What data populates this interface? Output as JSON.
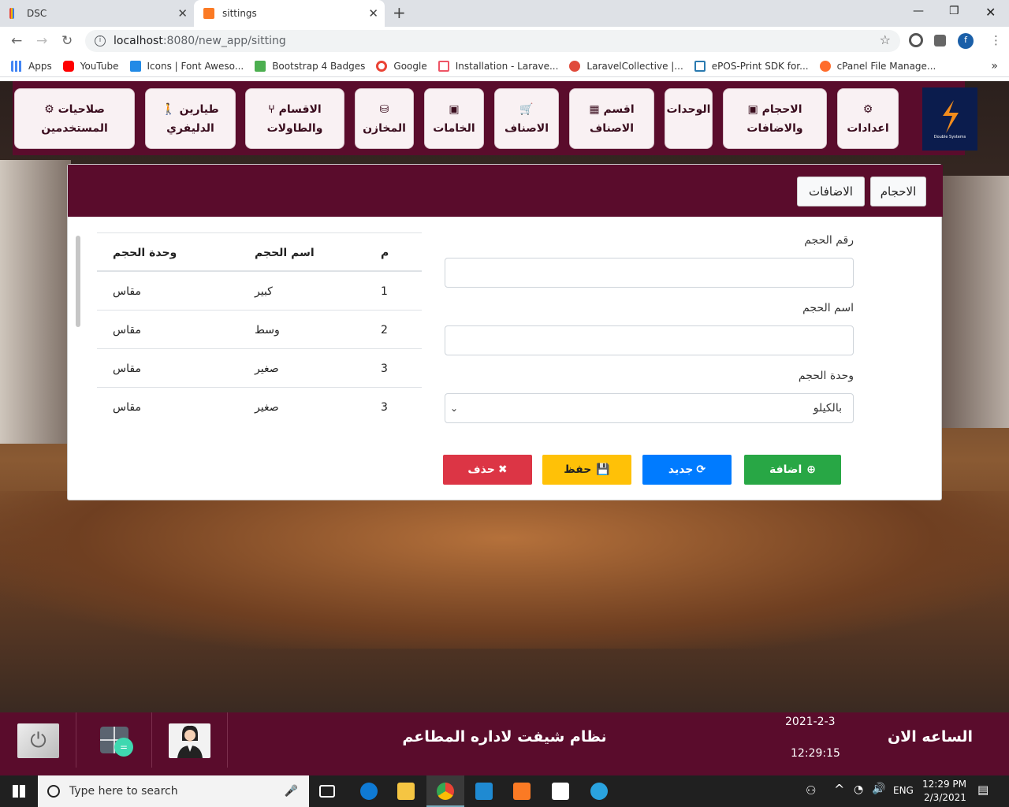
{
  "browser": {
    "tabs": [
      {
        "title": "DSC"
      },
      {
        "title": "sittings"
      }
    ],
    "url": "localhost:8080/new_app/sitting",
    "url_host": "localhost",
    "url_rest": ":8080/new_app/sitting",
    "bookmarks": [
      "Apps",
      "YouTube",
      "Icons | Font Aweso...",
      "Bootstrap 4 Badges",
      "Google",
      "Installation - Larave...",
      "LaravelCollective |...",
      "ePOS-Print SDK for...",
      "cPanel File Manage..."
    ],
    "profile_initial": "f"
  },
  "topnav": {
    "items": [
      {
        "line1": "صلاحيات",
        "line2": "المستخدمين",
        "icon": "users-cog-icon"
      },
      {
        "line1": "طيارين",
        "line2": "الدليفري",
        "icon": "walking-icon"
      },
      {
        "line1": "الاقسام",
        "line2": "والطاولات",
        "icon": "chair-icon"
      },
      {
        "line1": "",
        "line2": "المخازن",
        "icon": "database-icon"
      },
      {
        "line1": "",
        "line2": "الخامات",
        "icon": "folder-plus-icon"
      },
      {
        "line1": "",
        "line2": "الاصناف",
        "icon": "cart-icon"
      },
      {
        "line1": "اقسم",
        "line2": "الاصناف",
        "icon": "table-icon"
      },
      {
        "line1": "الوحدات",
        "line2": "",
        "icon": ""
      },
      {
        "line1": "الاحجام",
        "line2": "والاضافات",
        "icon": "folder-plus-icon"
      },
      {
        "line1": "",
        "line2": "اعدادات",
        "icon": "cogs-icon"
      }
    ],
    "logo_text": "Double Systems"
  },
  "card": {
    "tabs": {
      "sizes": "الاحجام",
      "additions": "الاضافات"
    },
    "form": {
      "number_label": "رقم الحجم",
      "name_label": "اسم الحجم",
      "unit_label": "وحدة الحجم",
      "unit_selected": "بالكيلو"
    },
    "buttons": {
      "add": "اضافة",
      "new": "جديد",
      "save": "حفظ",
      "delete": "حذف"
    },
    "table": {
      "headers": {
        "num": "م",
        "name": "اسم الحجم",
        "unit": "وحدة الحجم"
      },
      "rows": [
        {
          "num": "1",
          "name": "كبير",
          "unit": "مقاس"
        },
        {
          "num": "2",
          "name": "وسط",
          "unit": "مقاس"
        },
        {
          "num": "3",
          "name": "صغير",
          "unit": "مقاس"
        },
        {
          "num": "3",
          "name": "صغير",
          "unit": "مقاس"
        }
      ]
    }
  },
  "footer": {
    "now_label": "الساعه الان",
    "date": "2021-2-3",
    "time": "12:29:15",
    "system_title": "نظام شيفت لاداره المطاعم"
  },
  "taskbar": {
    "search_placeholder": "Type here to search",
    "lang": "ENG",
    "clock_time": "12:29 PM",
    "clock_date": "2/3/2021"
  },
  "colors": {
    "primary": "#5a0c2c",
    "add": "#28a745",
    "new": "#007bff",
    "save": "#ffc107",
    "delete": "#dc3545"
  }
}
